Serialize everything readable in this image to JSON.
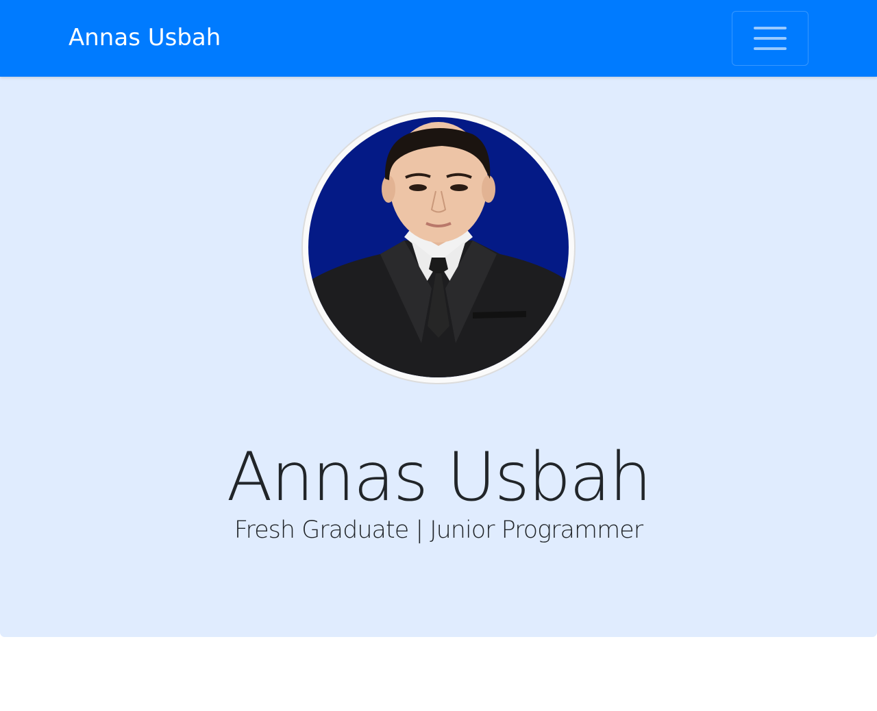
{
  "navbar": {
    "brand": "Annas Usbah",
    "toggler_icon": "hamburger-menu-icon"
  },
  "hero": {
    "photo": "profile-photo",
    "name": "Annas Usbah",
    "subtitle": "Fresh Graduate | Junior Programmer"
  },
  "colors": {
    "navbar": "#007bff",
    "hero_background": "#e0ecfe",
    "text": "#212529",
    "photo_background": "#041a86"
  }
}
